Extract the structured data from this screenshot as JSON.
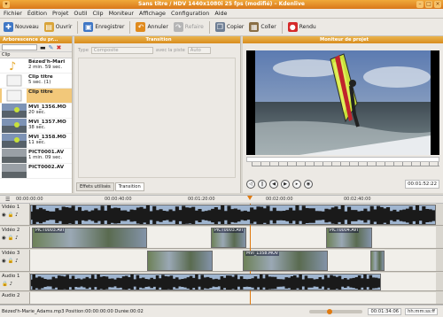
{
  "window": {
    "title": "Sans titre / HDV 1440x1080i 25 fps (modifié) – Kdenlive"
  },
  "menu": [
    "Fichier",
    "Édition",
    "Projet",
    "Outil",
    "Clip",
    "Moniteur",
    "Affichage",
    "Configuration",
    "Aide"
  ],
  "toolbar": [
    {
      "label": "Nouveau",
      "icon": "new-file-icon",
      "color": "#3f77c5",
      "enabled": true
    },
    {
      "label": "Ouvrir",
      "icon": "open-folder-icon",
      "color": "#d9a43a",
      "enabled": true
    },
    {
      "label": "Enregistrer",
      "icon": "save-icon",
      "color": "#3f77c5",
      "enabled": true
    },
    {
      "label": "Annuler",
      "icon": "undo-icon",
      "color": "#e08a1d",
      "enabled": true
    },
    {
      "label": "Refaire",
      "icon": "redo-icon",
      "color": "#b5b5b5",
      "enabled": false
    },
    {
      "label": "Copier",
      "icon": "copy-icon",
      "color": "#6f7f95",
      "enabled": true
    },
    {
      "label": "Coller",
      "icon": "paste-icon",
      "color": "#8a6f45",
      "enabled": true
    },
    {
      "label": "Rendu",
      "icon": "render-icon",
      "color": "#d52a2a",
      "enabled": true
    }
  ],
  "project": {
    "title": "Arborescence du pr...",
    "column": "Clip",
    "clips": [
      {
        "name": "Bézed'h-Mari",
        "info": "2 min. 59 sec.",
        "thumb": "audio",
        "selected": false
      },
      {
        "name": "Clip titre",
        "info": "5 sec. (1)",
        "thumb": "title",
        "selected": false
      },
      {
        "name": "Clip titre",
        "info": "",
        "thumb": "title",
        "selected": true
      },
      {
        "name": "MVI_1356.MO",
        "info": "20 sec.",
        "thumb": "sea",
        "selected": false
      },
      {
        "name": "MVI_1357.MO",
        "info": "38 sec.",
        "thumb": "sea",
        "selected": false
      },
      {
        "name": "MVI_1358.MO",
        "info": "11 sec.",
        "thumb": "sea",
        "selected": false
      },
      {
        "name": "PICT0001.AV",
        "info": "1 min. 09 sec.",
        "thumb": "grey",
        "selected": false
      },
      {
        "name": "PICT0002.AV",
        "info": "",
        "thumb": "grey",
        "selected": false
      }
    ]
  },
  "transition": {
    "title": "Transition",
    "type_label": "Type",
    "type_value": "Composite",
    "track_label": "avec la piste",
    "track_value": "Auto",
    "tabs": [
      "Effets utilisés",
      "Transition"
    ]
  },
  "monitor": {
    "title": "Moniteur de projet",
    "timecode": "00:01:52:22",
    "controls": [
      "◁",
      "‖",
      "◀",
      "▶",
      "▸",
      "◉"
    ]
  },
  "timeline": {
    "ruler": [
      "00:00:00:00",
      "00:00:40:00",
      "00:01:20:00",
      "00:02:00:00",
      "00:02:40:00"
    ],
    "tracks": [
      {
        "name": "Vidéo 1",
        "kind": "video"
      },
      {
        "name": "Vidéo 2",
        "kind": "video"
      },
      {
        "name": "Vidéo 3",
        "kind": "video"
      },
      {
        "name": "Audio 1",
        "kind": "audio"
      },
      {
        "name": "Audio 2",
        "kind": "audio"
      }
    ],
    "clip_labels": [
      "PICT0003.AVI",
      "PICT0003.AVI",
      "PICT0004.AVI",
      "MVI_1358.MOV"
    ]
  },
  "status": {
    "text": "Bézed'h-Marie_Adams.mp3 Position:00:00:00:00 Durée:00:02",
    "timecode": "00:01:34:06",
    "format": "hh:mm:ss:ff"
  }
}
